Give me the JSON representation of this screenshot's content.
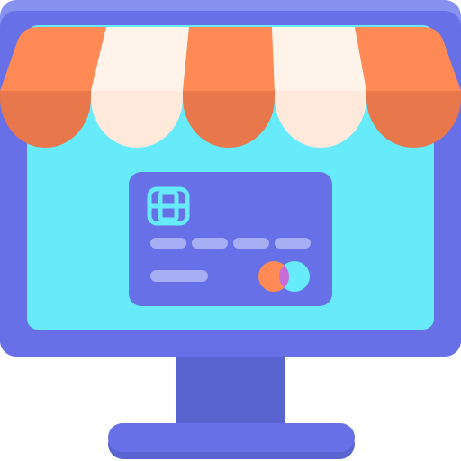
{
  "colors": {
    "monitor_frame": "#6770E6",
    "monitor_top_edge": "#8791F0",
    "screen": "#67EAFA",
    "stand": "#5A64D0",
    "base": "#6770E6",
    "base_shadow": "#5A64D0",
    "awning_orange": "#FF8A55",
    "awning_orange_dark": "#E8784B",
    "awning_cream": "#FFF3EA",
    "awning_cream_shade": "#FFE9DB",
    "card_body": "#6770E6",
    "card_chip": "#67EAFA",
    "card_stripes": "#A8AEF3",
    "logo_left": "#FF8A55",
    "logo_right": "#67EAFA",
    "logo_overlap": "#C66CD6"
  },
  "icons": {
    "main": "online-store-monitor-icon",
    "awning": "shop-awning-icon",
    "card": "credit-card-icon",
    "chip": "card-chip-icon",
    "logo": "card-network-logo-icon"
  }
}
